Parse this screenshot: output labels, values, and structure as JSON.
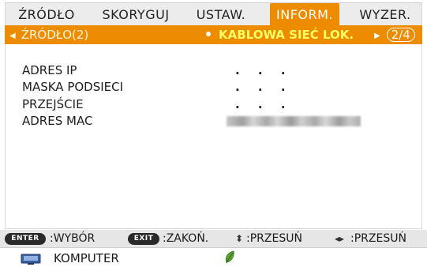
{
  "tabs": [
    "ŹRÓDŁO",
    "SKORYGUJ",
    "USTAW.",
    "INFORM.",
    "WYZER."
  ],
  "active_tab": "INFORM.",
  "subbar": {
    "left_label": "ŹRÓDŁO(2)",
    "center_label": "KABLOWA SIEĆ LOK.",
    "page": "2/4"
  },
  "info_rows": [
    {
      "label": "ADRES IP",
      "value": ". . ."
    },
    {
      "label": "MASKA PODSIECI",
      "value": ". . ."
    },
    {
      "label": "PRZEJŚCIE",
      "value": ". . ."
    },
    {
      "label": "ADRES MAC",
      "value": ""
    }
  ],
  "help": {
    "enter_key": "ENTER",
    "enter_text": ":WYBÓR",
    "exit_key": "EXIT",
    "exit_text": ":ZAKOŃ.",
    "move_v_text": ":PRZESUŃ",
    "move_h_text": ":PRZESUŃ"
  },
  "source": {
    "label": "KOMPUTER"
  },
  "colors": {
    "accent": "#ee8c00",
    "highlight_text": "#ffff66",
    "leaf": "#5aa832"
  },
  "icons": [
    "left-arrow-icon",
    "dot-icon",
    "right-arrow-icon",
    "up-down-arrows-icon",
    "left-right-arrows-icon",
    "monitor-icon",
    "eco-leaf-icon"
  ]
}
